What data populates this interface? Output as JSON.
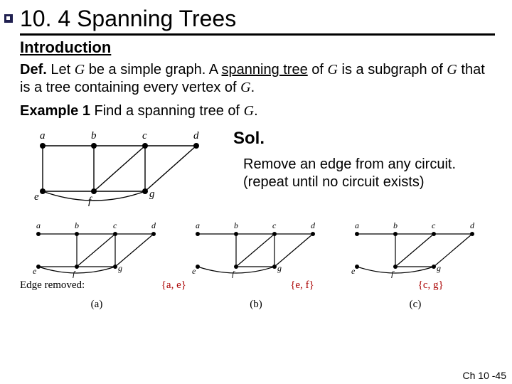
{
  "title": "10. 4 Spanning Trees",
  "subtitle": "Introduction",
  "def_label": "Def.",
  "def_pre": " Let ",
  "G": "G",
  "def_mid1": "  be a simple graph. A ",
  "term": "spanning tree",
  "def_mid2": " of ",
  "def_mid3": " is a subgraph of ",
  "def_mid4": " that is a tree containing every vertex of ",
  "period": ".",
  "ex_label": "Example 1",
  "ex_text1": " Find a spanning tree of ",
  "sol_label": "Sol.",
  "sol_line1": "Remove an edge from any circuit.",
  "sol_line2": "(repeat until no circuit exists)",
  "edge_removed_label": "Edge removed:",
  "removed": {
    "a": "{a, e}",
    "b": "{e, f}",
    "c": "{c, g}"
  },
  "sub": {
    "a": "(a)",
    "b": "(b)",
    "c": "(c)"
  },
  "v": {
    "a": "a",
    "b": "b",
    "c": "c",
    "d": "d",
    "e": "e",
    "f": "f",
    "g": "g"
  },
  "footer": "Ch 10 -45"
}
